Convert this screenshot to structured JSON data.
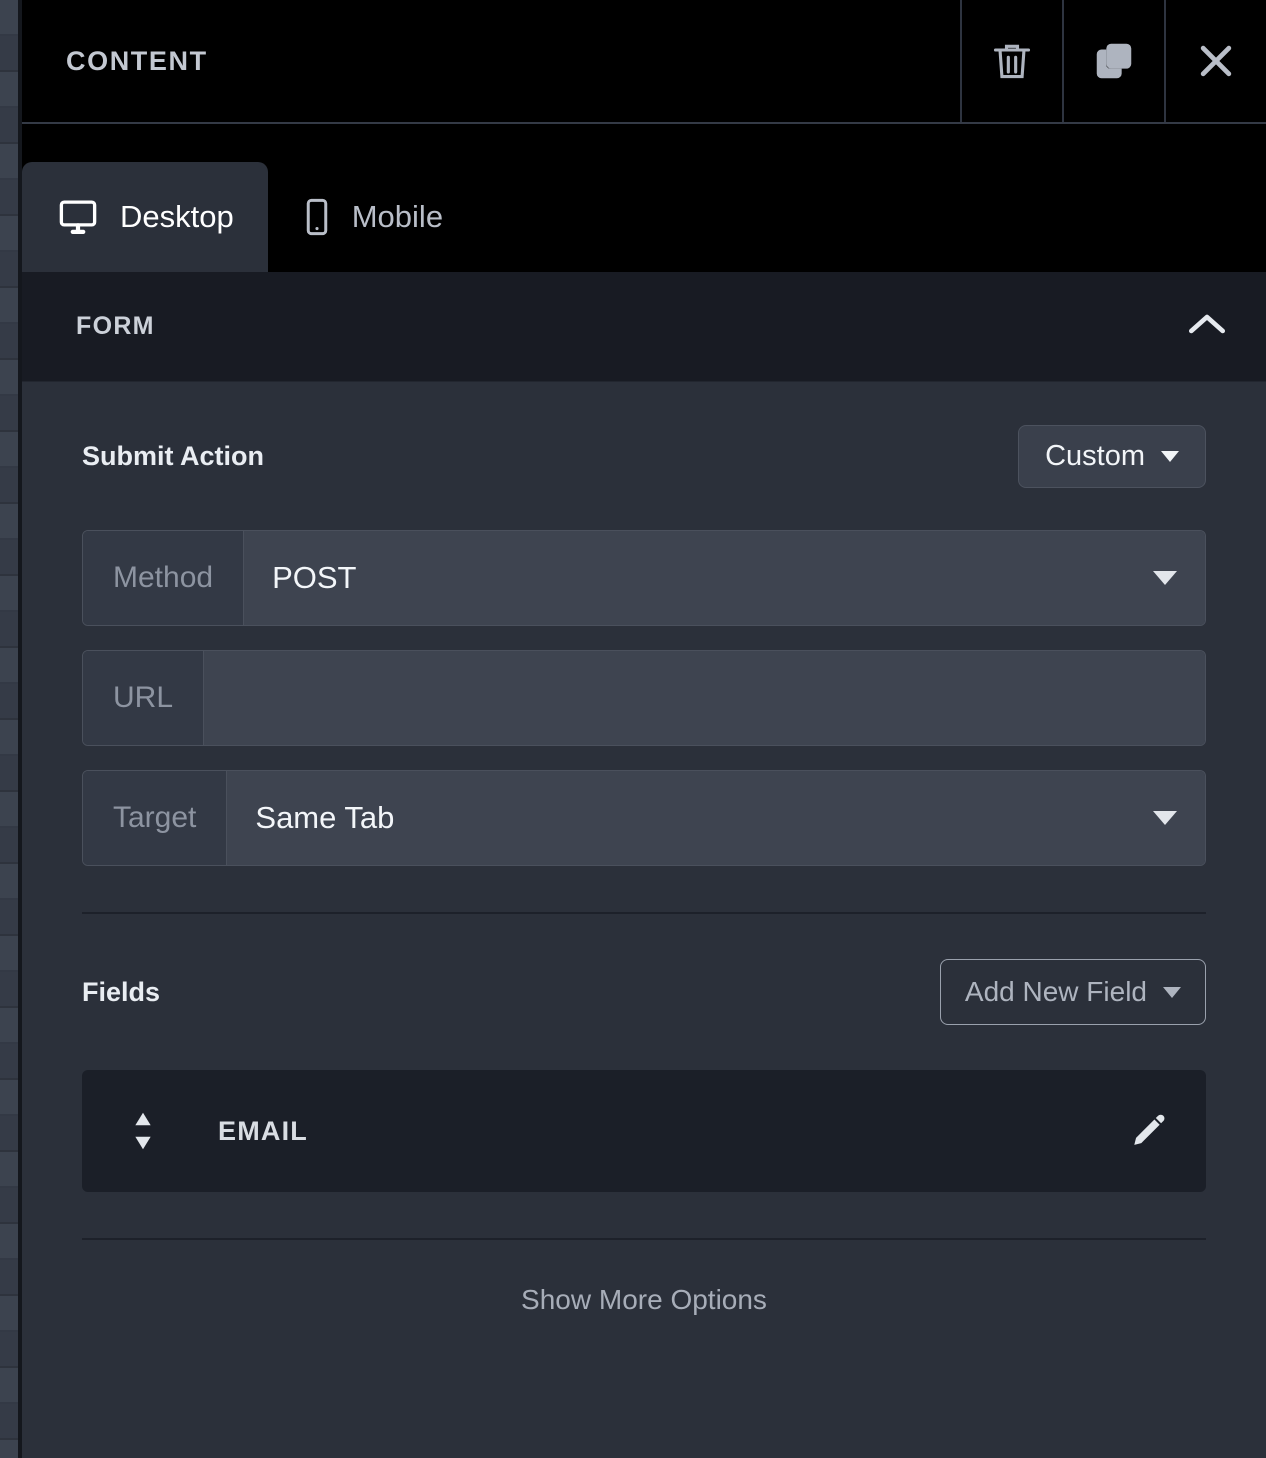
{
  "header": {
    "title": "CONTENT",
    "actions": [
      {
        "name": "delete-button",
        "icon": "trash-icon"
      },
      {
        "name": "duplicate-button",
        "icon": "copy-icon"
      },
      {
        "name": "close-button",
        "icon": "close-icon"
      }
    ]
  },
  "tabs": [
    {
      "label": "Desktop",
      "icon": "desktop-icon",
      "active": true
    },
    {
      "label": "Mobile",
      "icon": "mobile-icon",
      "active": false
    }
  ],
  "form_section": {
    "title": "FORM",
    "collapse_icon": "chevron-up-icon",
    "submit_action": {
      "label": "Submit Action",
      "value": "Custom"
    },
    "inputs": [
      {
        "label": "Method",
        "value": "POST",
        "type": "select",
        "placeholder": ""
      },
      {
        "label": "URL",
        "value": "",
        "type": "text",
        "placeholder": ""
      },
      {
        "label": "Target",
        "value": "Same Tab",
        "type": "select",
        "placeholder": ""
      }
    ],
    "fields": {
      "label": "Fields",
      "add_button": "Add New Field",
      "items": [
        {
          "name": "EMAIL",
          "handle_icon": "sort-handle-icon",
          "edit_icon": "pencil-icon"
        }
      ]
    },
    "show_more": "Show More Options"
  },
  "colors": {
    "panel_bg": "#2b303a",
    "header_bg": "#000000",
    "section_header_bg": "#181b23",
    "input_bg": "#3e4450",
    "input_prefix_bg": "#333945",
    "field_row_bg": "#1b1f28",
    "text_primary": "#f2f5f8",
    "text_muted": "#8d94a1"
  }
}
